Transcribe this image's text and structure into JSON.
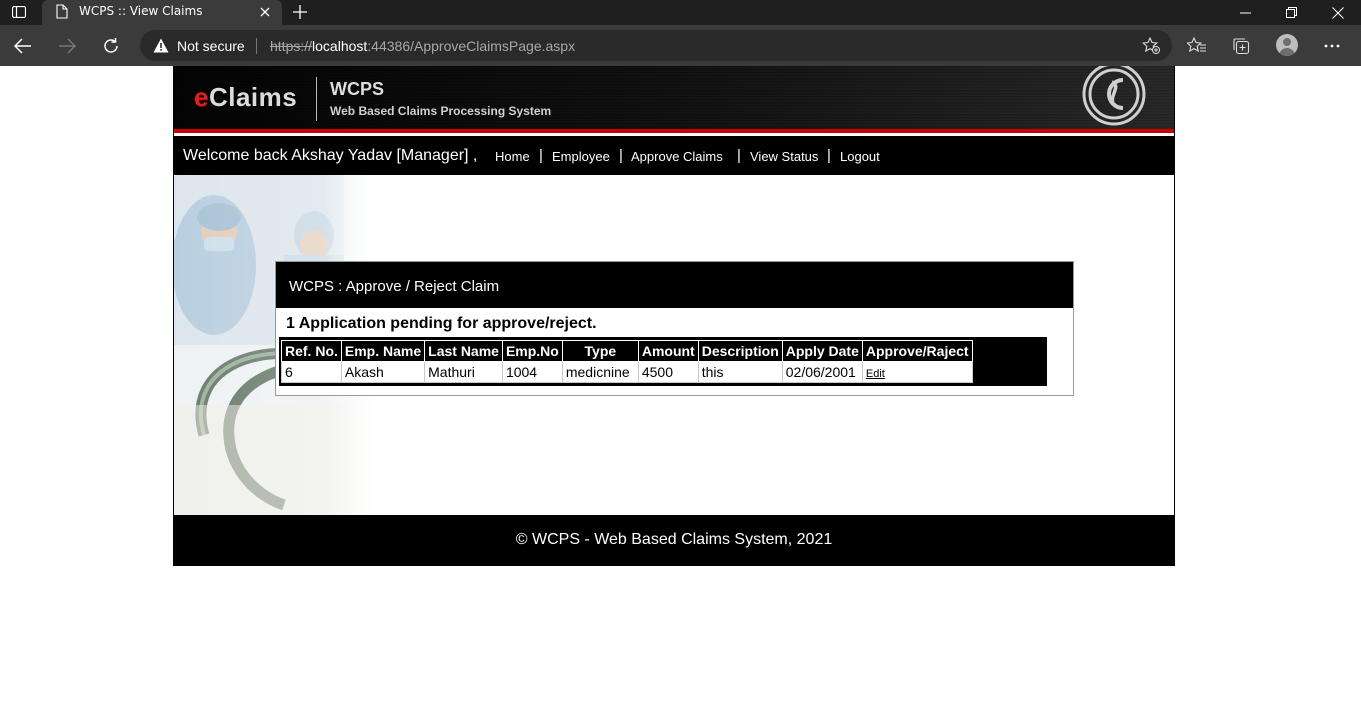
{
  "browser": {
    "tab_title": "WCPS :: View Claims",
    "security_label": "Not secure",
    "url_scheme": "https://",
    "url_host": "localhost",
    "url_rest": ":44386/ApproveClaimsPage.aspx"
  },
  "header": {
    "logo_e": "e",
    "logo_rest": "Claims",
    "app_title": "WCPS",
    "app_subtitle": "Web Based Claims Processing System"
  },
  "nav": {
    "welcome": "Welcome back Akshay Yadav [Manager] ,",
    "items": [
      {
        "label": "Home"
      },
      {
        "label": "Employee"
      },
      {
        "label": "Approve Claims"
      },
      {
        "label": "View Status"
      },
      {
        "label": "Logout"
      }
    ],
    "separator": "|"
  },
  "panel": {
    "title": "WCPS : Approve / Reject Claim",
    "pending_text": "1 Application pending for approve/reject."
  },
  "claims_table": {
    "columns": [
      "Ref. No.",
      "Emp. Name",
      "Last Name",
      "Emp.No",
      "Type",
      "Amount",
      "Description",
      "Apply Date",
      "Approve/Raject"
    ],
    "rows": [
      {
        "ref_no": "6",
        "emp_name": "Akash",
        "last_name": "Mathuri",
        "emp_no": "1004",
        "type": "medicnine",
        "amount": "4500",
        "description": "this",
        "apply_date": "02/06/2001",
        "action": "Edit"
      }
    ]
  },
  "footer": {
    "text": "© WCPS - Web Based Claims System, 2021"
  },
  "colors": {
    "chrome_dark": "#1f1f1f",
    "chrome_toolbar": "#3b3b3b",
    "header_red_stripe": "#cc0000",
    "page_black": "#000000"
  }
}
